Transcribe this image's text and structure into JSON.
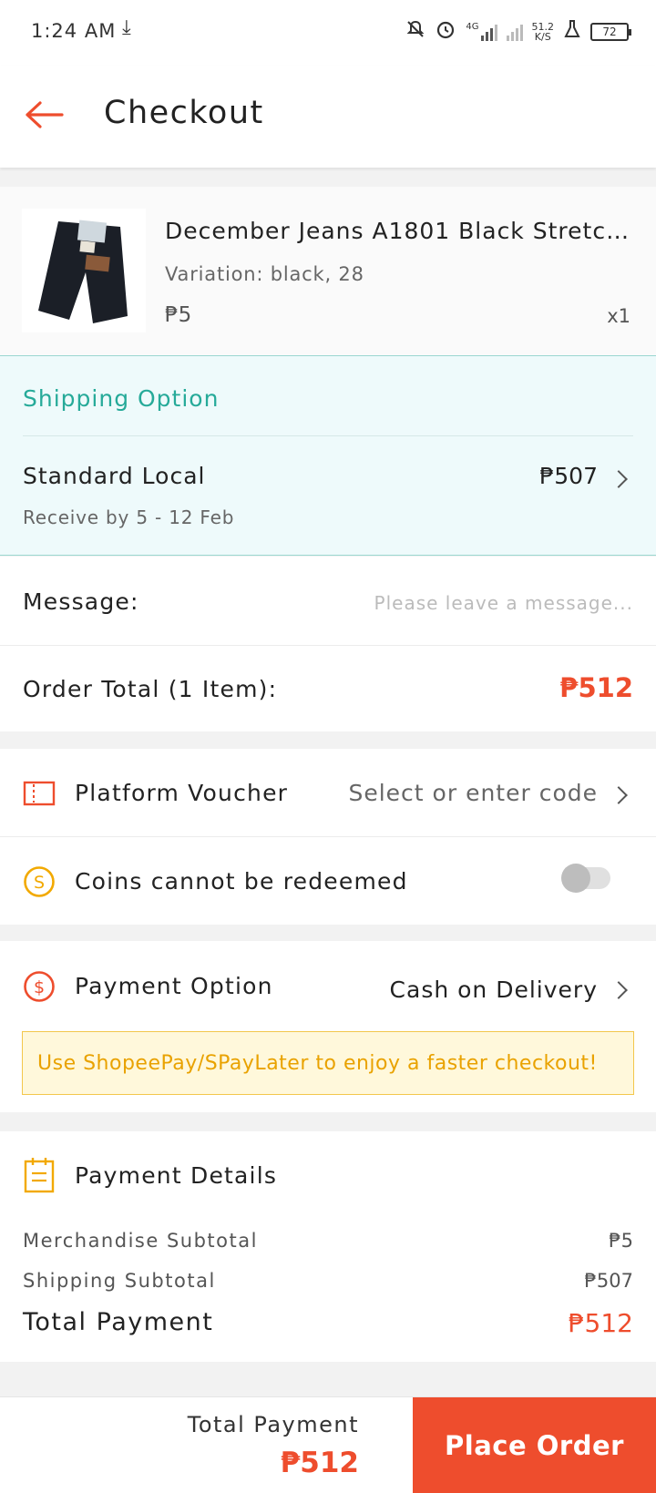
{
  "status_bar": {
    "time": "1:24 AM",
    "network_type": "4G",
    "net_speed_value": "51.2",
    "net_speed_unit": "K/S",
    "battery": "72"
  },
  "header": {
    "title": "Checkout"
  },
  "product": {
    "name": "December Jeans A1801 Black Stretchable",
    "variation": "Variation: black, 28",
    "price": "₱5",
    "quantity": "x1"
  },
  "shipping": {
    "section_title": "Shipping Option",
    "method": "Standard Local",
    "eta": "Receive by 5 - 12 Feb",
    "price": "₱507"
  },
  "message": {
    "label": "Message:",
    "placeholder": "Please leave a message..."
  },
  "order_total": {
    "label": "Order Total (1 Item):",
    "amount": "₱512"
  },
  "voucher": {
    "label": "Platform Voucher",
    "value": "Select or enter code"
  },
  "coins": {
    "label": "Coins cannot be redeemed",
    "enabled": false
  },
  "payment": {
    "label": "Payment Option",
    "value": "Cash on Delivery",
    "promo": "Use ShopeePay/SPayLater to enjoy a faster checkout!"
  },
  "payment_details": {
    "title": "Payment Details",
    "merch_label": "Merchandise Subtotal",
    "merch_value": "₱5",
    "ship_label": "Shipping Subtotal",
    "ship_value": "₱507",
    "total_label": "Total Payment",
    "total_value": "₱512"
  },
  "bottom_bar": {
    "total_label": "Total Payment",
    "total_amount": "₱512",
    "place_order_label": "Place Order"
  },
  "colors": {
    "brand": "#ee4d2d",
    "shipping_accent": "#26aa99",
    "promo": "#e9a200"
  }
}
